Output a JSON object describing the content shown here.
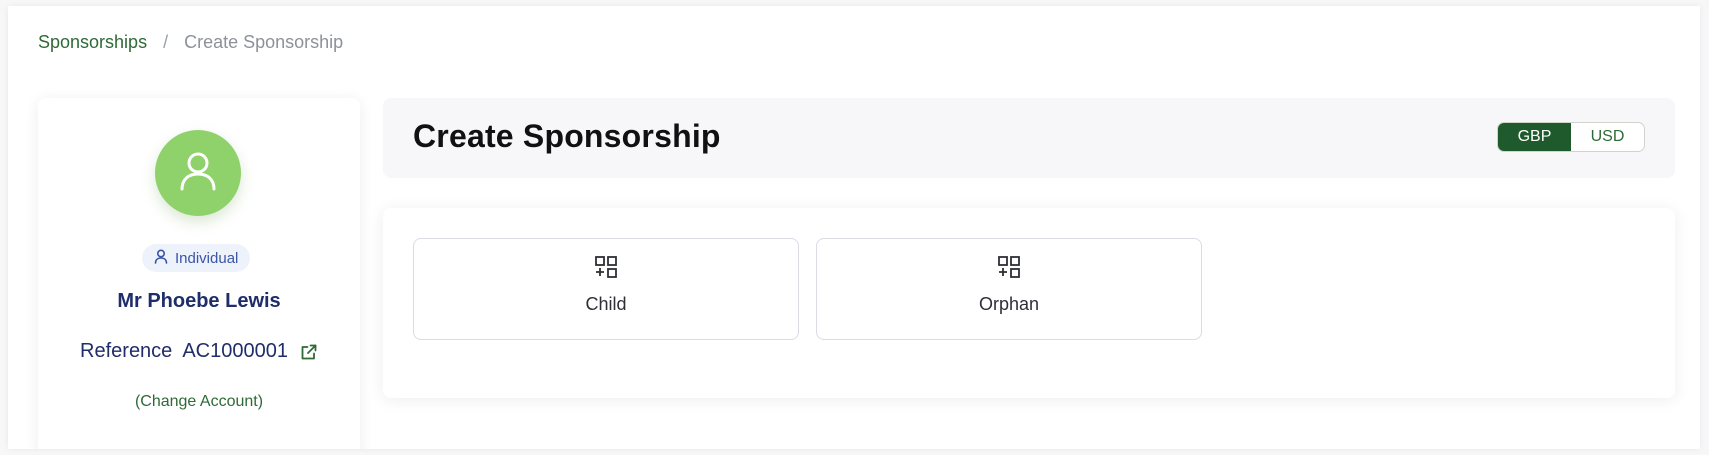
{
  "breadcrumb": {
    "parent": "Sponsorships",
    "separator": "/",
    "current": "Create Sponsorship"
  },
  "account": {
    "avatar_icon": "user-icon",
    "type_badge": "Individual",
    "name": "Mr Phoebe Lewis",
    "reference_label": "Reference",
    "reference_value": "AC1000001",
    "reference_icon": "external-link-icon",
    "change_account": "(Change Account)"
  },
  "header": {
    "title": "Create Sponsorship",
    "currencies": [
      {
        "label": "GBP",
        "active": true
      },
      {
        "label": "USD",
        "active": false
      }
    ]
  },
  "options": [
    {
      "label": "Child",
      "icon": "add-grid-icon"
    },
    {
      "label": "Orphan",
      "icon": "add-grid-icon"
    }
  ],
  "colors": {
    "brand_green": "#1f5a2d",
    "avatar_green": "#8fd16a",
    "name_navy": "#1f2d6b",
    "badge_blue": "#3a55a8"
  }
}
